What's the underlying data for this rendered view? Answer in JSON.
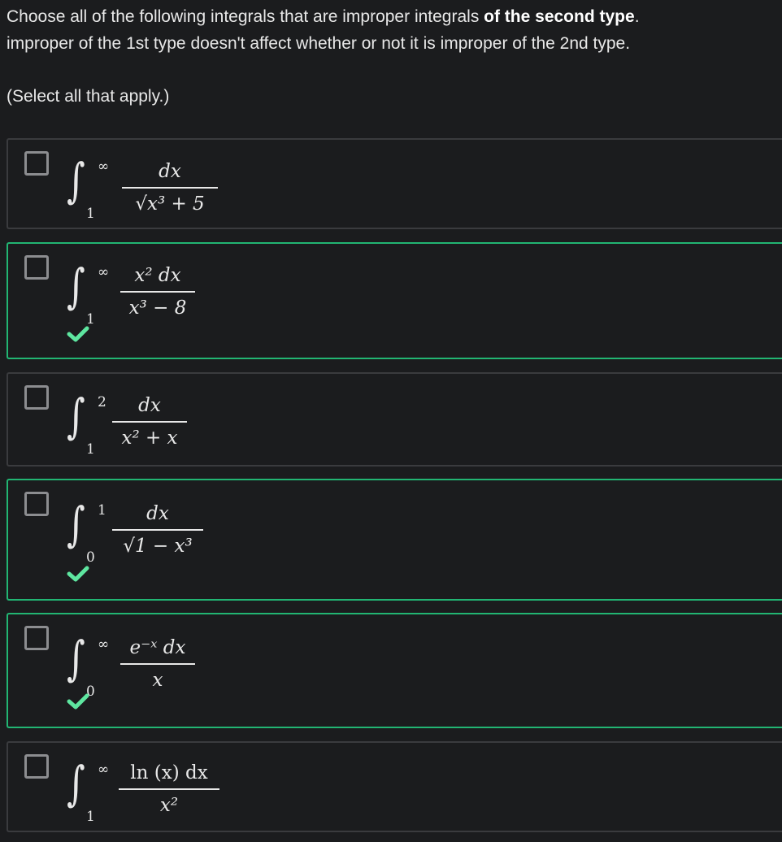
{
  "prompt": {
    "line1_start": "Choose all of the following integrals that are improper integrals ",
    "line1_bold": "of the second type",
    "line1_end": ".",
    "line2": "improper of the 1st type doesn't affect whether or not it is improper of the 2nd type."
  },
  "instruction": "(Select all that apply.)",
  "options": [
    {
      "upper": "∞",
      "lower": "1",
      "numerator": "dx",
      "denominator": "√x³ + 5",
      "correct": false
    },
    {
      "upper": "∞",
      "lower": "1",
      "numerator": "x² dx",
      "denominator": "x³ − 8",
      "correct": true
    },
    {
      "upper": "2",
      "lower": "1",
      "numerator": "dx",
      "denominator": "x² + x",
      "correct": false
    },
    {
      "upper": "1",
      "lower": "0",
      "numerator": "dx",
      "denominator": "√1 − x³",
      "correct": true
    },
    {
      "upper": "∞",
      "lower": "0",
      "numerator": "e⁻ˣ dx",
      "denominator": "x",
      "correct": true
    },
    {
      "upper": "∞",
      "lower": "1",
      "numerator": "ln (x) dx",
      "denominator": "x²",
      "correct": false
    }
  ],
  "colors": {
    "correct_border": "#22b573",
    "checkmark": "#5ee6a0",
    "default_border": "#3a3b3e"
  }
}
